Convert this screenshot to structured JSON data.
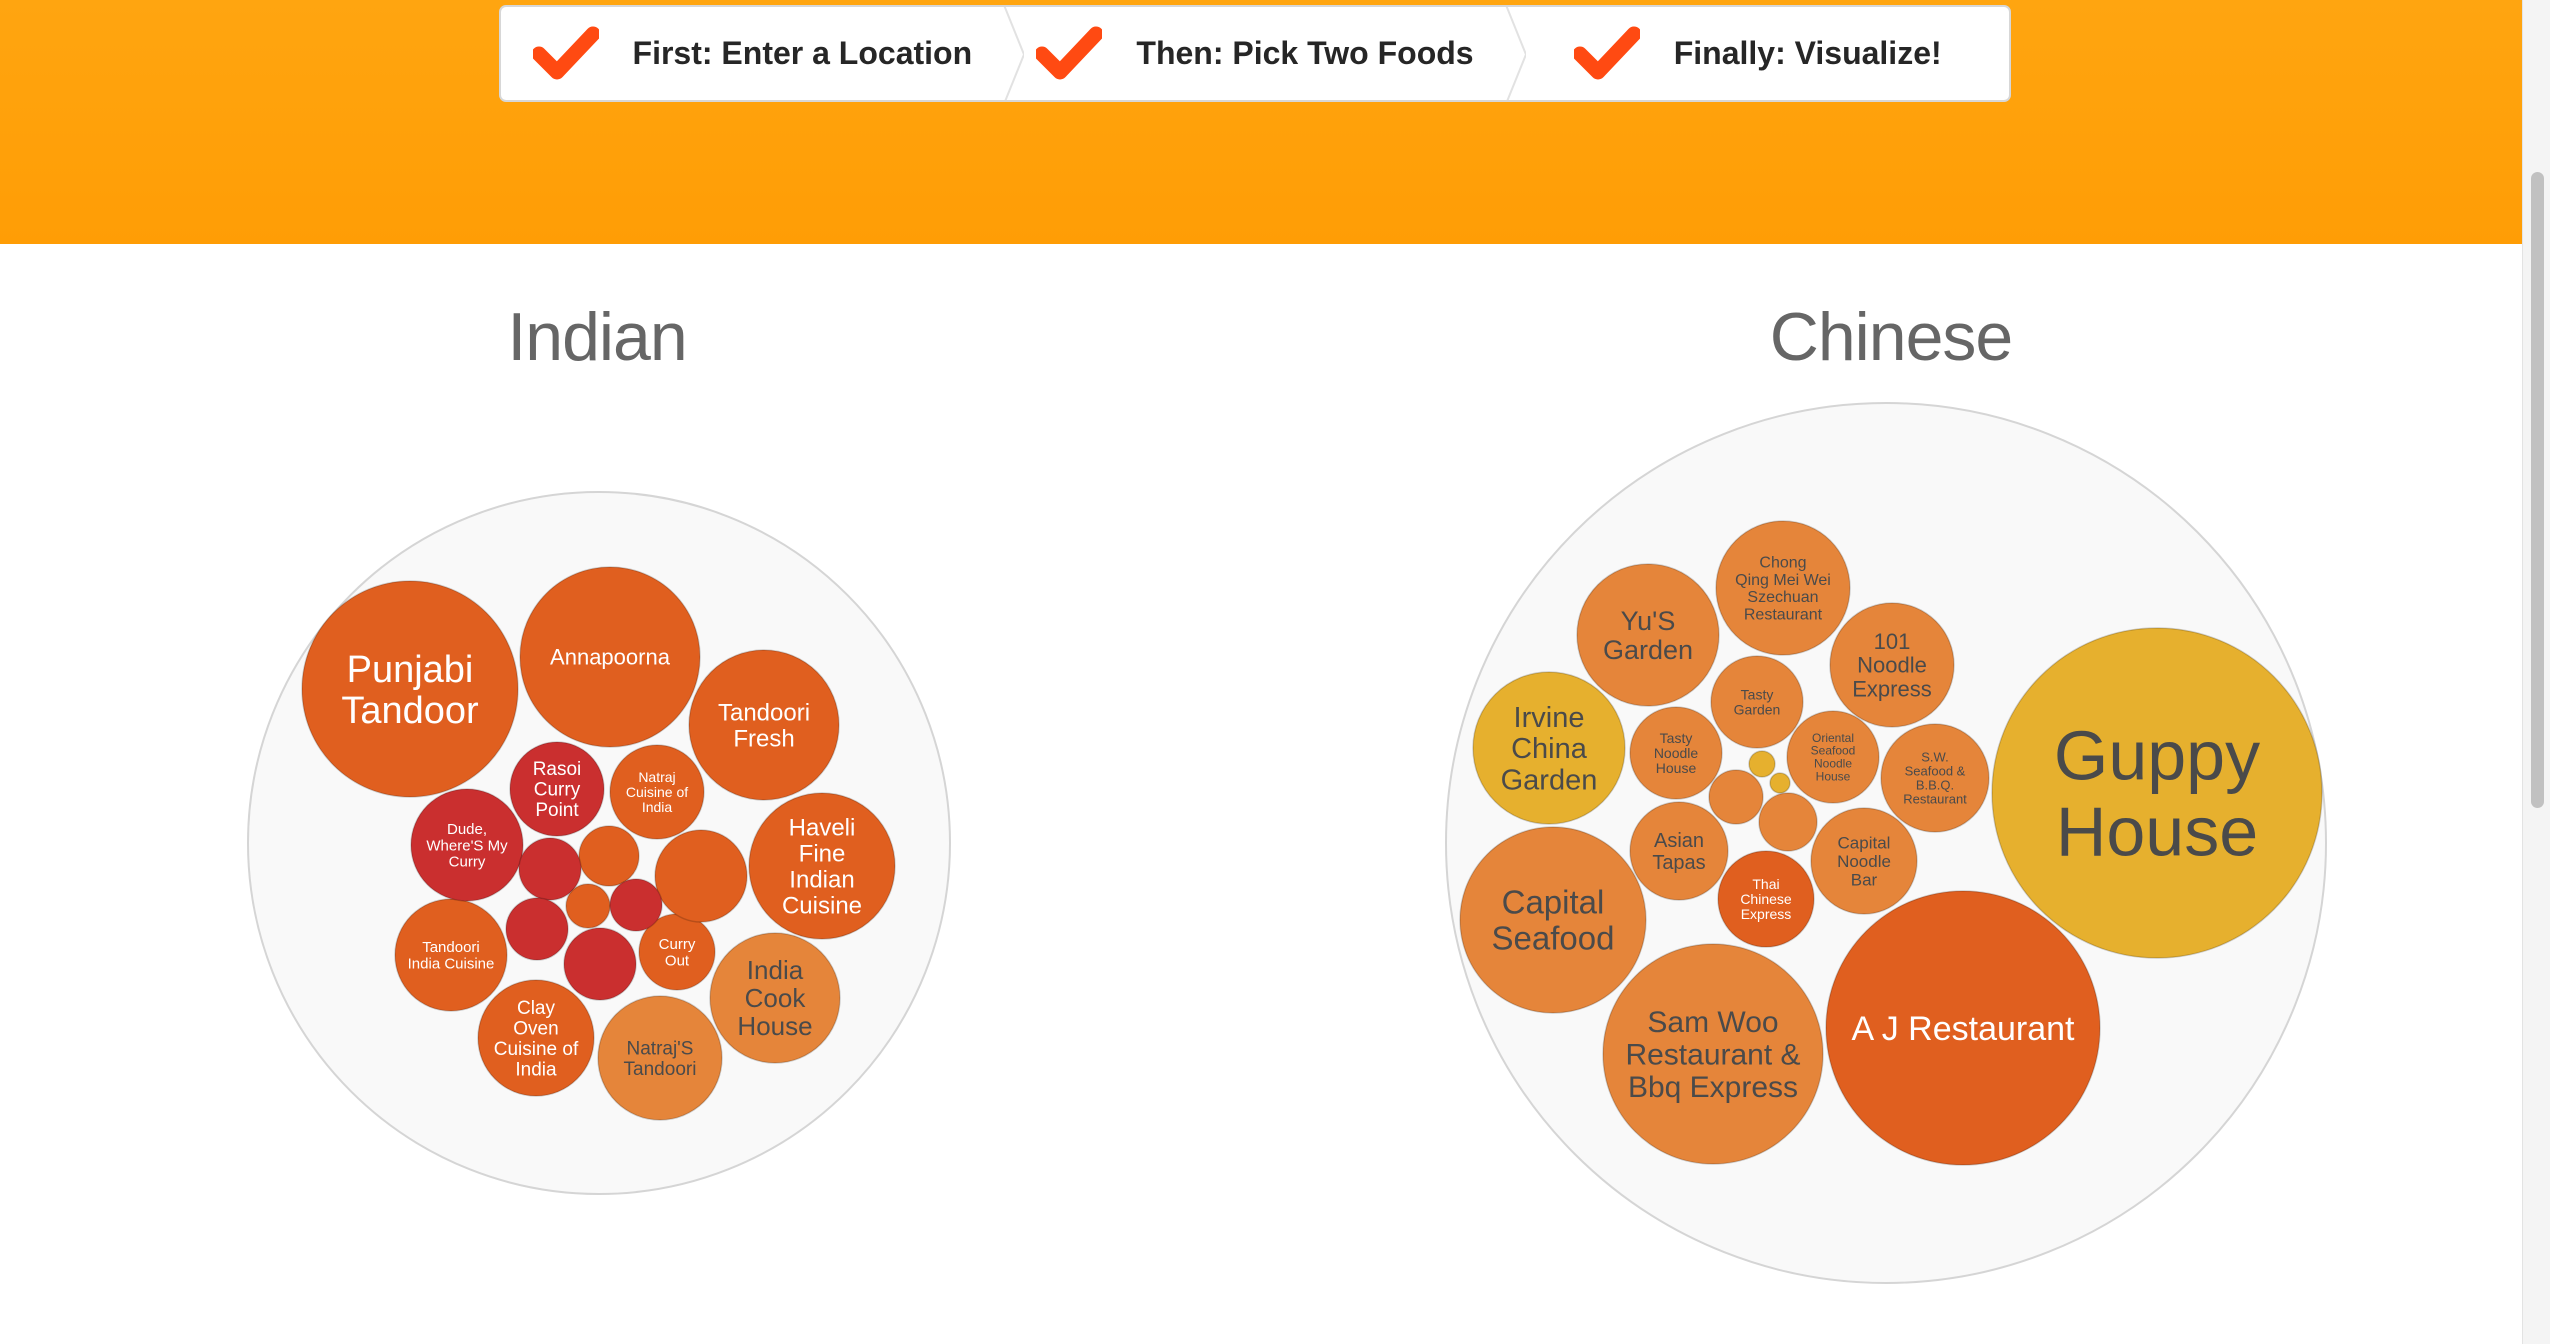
{
  "steps": [
    {
      "label": "First: Enter a Location",
      "icon": "check-icon"
    },
    {
      "label": "Then: Pick Two Foods",
      "icon": "check-icon"
    },
    {
      "label": "Finally: Visualize!",
      "icon": "check-icon"
    }
  ],
  "colors": {
    "hero": "#ffa510",
    "check": "#ff4a12",
    "packFill": "#f9f9f9",
    "packStroke": "#d5d5d5",
    "title": "#666666"
  },
  "charts": [
    {
      "title": "Indian",
      "restaurants": [
        {
          "name": "Punjabi Tandoor",
          "lines": [
            "Punjabi",
            "Tandoor"
          ],
          "color": "#e05f1f"
        },
        {
          "name": "Annapoorna",
          "lines": [
            "Annapoorna"
          ],
          "color": "#e05f1f"
        },
        {
          "name": "Tandoori Fresh",
          "lines": [
            "Tandoori",
            "Fresh"
          ],
          "color": "#e05f1f"
        },
        {
          "name": "Haveli Fine Indian Cuisine",
          "lines": [
            "Haveli",
            "Fine",
            "Indian",
            "Cuisine"
          ],
          "color": "#e05f1f"
        },
        {
          "name": "India Cook House",
          "lines": [
            "India",
            "Cook",
            "House"
          ],
          "color": "#e5853a"
        },
        {
          "name": "Natraj'S Tandoori",
          "lines": [
            "Natraj'S",
            "Tandoori"
          ],
          "color": "#e5853a"
        },
        {
          "name": "Clay Oven Cuisine of India",
          "lines": [
            "Clay",
            "Oven",
            "Cuisine of",
            "India"
          ],
          "color": "#e05f1f"
        },
        {
          "name": "Tandoori India Cuisine",
          "lines": [
            "Tandoori",
            "India Cuisine"
          ],
          "color": "#e05f1f"
        },
        {
          "name": "Dude, Where'S My Curry",
          "lines": [
            "Dude,",
            "Where'S My",
            "Curry"
          ],
          "color": "#ca2f2f"
        },
        {
          "name": "Rasoi Curry Point",
          "lines": [
            "Rasoi",
            "Curry",
            "Point"
          ],
          "color": "#ca2f2f"
        },
        {
          "name": "Natraj Cuisine of India",
          "lines": [
            "Natraj",
            "Cuisine of",
            "India"
          ],
          "color": "#e05f1f"
        },
        {
          "name": "Curry Out",
          "lines": [
            "Curry",
            "Out"
          ],
          "color": "#e05f1f"
        },
        {
          "name": "",
          "lines": [],
          "color": "#e05f1f"
        },
        {
          "name": "",
          "lines": [],
          "color": "#e05f1f"
        },
        {
          "name": "",
          "lines": [],
          "color": "#ca2f2f"
        },
        {
          "name": "",
          "lines": [],
          "color": "#e05f1f"
        },
        {
          "name": "",
          "lines": [],
          "color": "#ca2f2f"
        },
        {
          "name": "",
          "lines": [],
          "color": "#ca2f2f"
        },
        {
          "name": "",
          "lines": [],
          "color": "#ca2f2f"
        }
      ]
    },
    {
      "title": "Chinese",
      "restaurants": [
        {
          "name": "Guppy House",
          "lines": [
            "Guppy",
            "House"
          ],
          "color": "#e6b02e"
        },
        {
          "name": "A J Restaurant",
          "lines": [
            "A J Restaurant"
          ],
          "color": "#e05f1f"
        },
        {
          "name": "Sam Woo Restaurant & Bbq Express",
          "lines": [
            "Sam Woo",
            "Restaurant &",
            "Bbq Express"
          ],
          "color": "#e5853a"
        },
        {
          "name": "Capital Seafood",
          "lines": [
            "Capital",
            "Seafood"
          ],
          "color": "#e5853a"
        },
        {
          "name": "Irvine China Garden",
          "lines": [
            "Irvine",
            "China",
            "Garden"
          ],
          "color": "#e6b02e"
        },
        {
          "name": "Yu'S Garden",
          "lines": [
            "Yu'S",
            "Garden"
          ],
          "color": "#e5853a"
        },
        {
          "name": "Chong Qing Mei Wei Szechuan Restaurant",
          "lines": [
            "Chong",
            "Qing Mei Wei",
            "Szechuan",
            "Restaurant"
          ],
          "color": "#e5853a"
        },
        {
          "name": "101 Noodle Express",
          "lines": [
            "101",
            "Noodle",
            "Express"
          ],
          "color": "#e5853a"
        },
        {
          "name": "Tasty Garden",
          "lines": [
            "Tasty",
            "Garden"
          ],
          "color": "#e5853a"
        },
        {
          "name": "Tasty Noodle House",
          "lines": [
            "Tasty",
            "Noodle",
            "House"
          ],
          "color": "#e5853a"
        },
        {
          "name": "Oriental Seafood Noodle House",
          "lines": [
            "Oriental",
            "Seafood",
            "Noodle",
            "House"
          ],
          "color": "#e5853a"
        },
        {
          "name": "S.W. Seafood & B.B.Q. Restaurant",
          "lines": [
            "S.W.",
            "Seafood &",
            "B.B.Q.",
            "Restaurant"
          ],
          "color": "#e5853a"
        },
        {
          "name": "Asian Tapas",
          "lines": [
            "Asian",
            "Tapas"
          ],
          "color": "#e5853a"
        },
        {
          "name": "Capital Noodle Bar",
          "lines": [
            "Capital",
            "Noodle",
            "Bar"
          ],
          "color": "#e5853a"
        },
        {
          "name": "Thai Chinese Express",
          "lines": [
            "Thai",
            "Chinese",
            "Express"
          ],
          "color": "#e05f1f"
        },
        {
          "name": "",
          "lines": [],
          "color": "#e5853a"
        },
        {
          "name": "",
          "lines": [],
          "color": "#e5853a"
        },
        {
          "name": "",
          "lines": [],
          "color": "#e6b02e"
        },
        {
          "name": "",
          "lines": [],
          "color": "#e5853a"
        },
        {
          "name": "",
          "lines": [],
          "color": "#e6b02e"
        }
      ]
    }
  ]
}
